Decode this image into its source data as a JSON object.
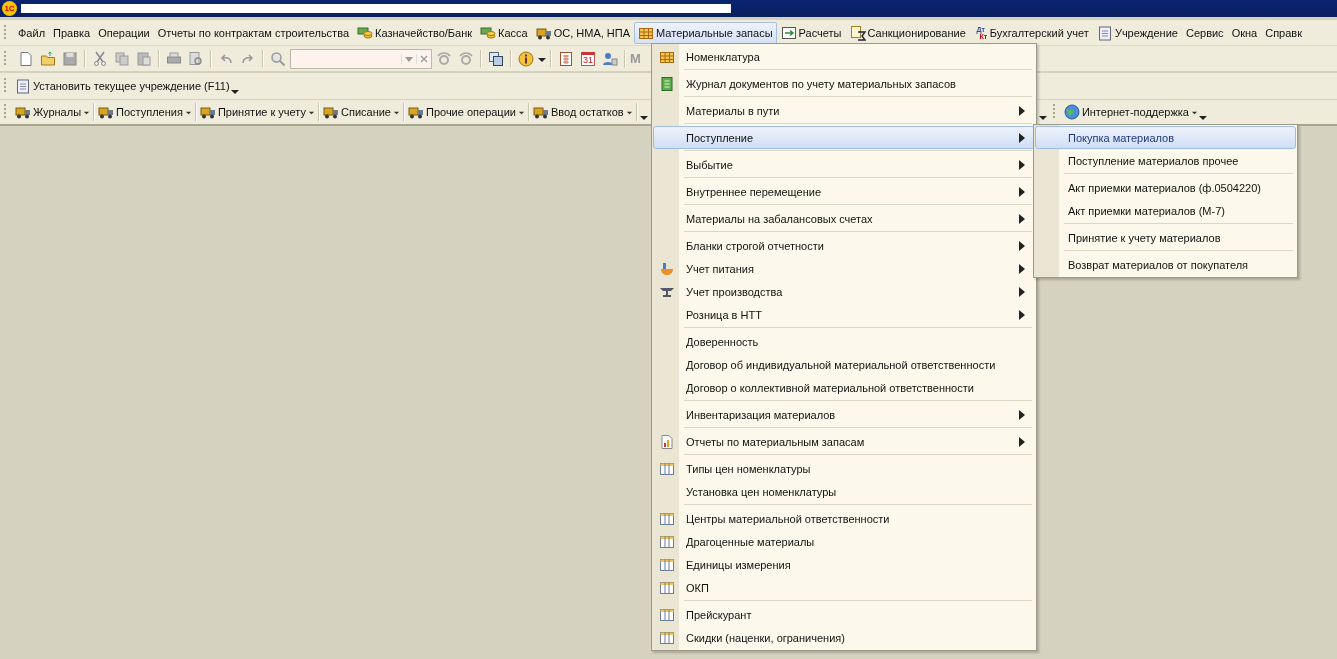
{
  "window": {
    "logo": "1С"
  },
  "menu_bar": [
    {
      "label": "Файл",
      "selected": false
    },
    {
      "label": "Правка",
      "selected": false
    },
    {
      "label": "Операции",
      "selected": false
    },
    {
      "label": "Отчеты по контрактам строительства",
      "selected": false
    },
    {
      "label": "Казначейство/Банк",
      "selected": false
    },
    {
      "label": "Касса",
      "selected": false
    },
    {
      "label": "ОС, НМА, НПА",
      "selected": false
    },
    {
      "label": "Материальные запасы",
      "selected": true
    },
    {
      "label": "Расчеты",
      "selected": false
    },
    {
      "label": "Санкционирование",
      "selected": false
    },
    {
      "label": "Бухгалтерский учет",
      "selected": false,
      "icon_top": "Дт",
      "icon_bottom": "Кт"
    },
    {
      "label": "Учреждение",
      "selected": false
    },
    {
      "label": "Сервис",
      "selected": false
    },
    {
      "label": "Окна",
      "selected": false
    },
    {
      "label": "Справк",
      "selected": false
    }
  ],
  "toolbar": {
    "calendar_day": "31",
    "cut_text": "M"
  },
  "institution_button": {
    "label": "Установить текущее учреждение (F11)"
  },
  "journal_toolbar": [
    {
      "label": "Журналы"
    },
    {
      "label": "Поступления"
    },
    {
      "label": "Принятие к учету"
    },
    {
      "label": "Списание"
    },
    {
      "label": "Прочие операции"
    },
    {
      "label": "Ввод остатков"
    }
  ],
  "support_button": {
    "label": "Интернет-поддержка"
  },
  "dropdown": [
    [
      {
        "label": "Номенклатура",
        "kind": "command",
        "selected": false
      }
    ],
    [
      {
        "label": "Журнал документов по учету материальных запасов",
        "kind": "command",
        "selected": false
      }
    ],
    [
      {
        "label": "Материалы в пути",
        "kind": "submenu",
        "selected": false
      }
    ],
    [
      {
        "label": "Поступление",
        "kind": "submenu",
        "selected": true
      }
    ],
    [
      {
        "label": "Выбытие",
        "kind": "submenu",
        "selected": false
      }
    ],
    [
      {
        "label": "Внутреннее перемещение",
        "kind": "submenu",
        "selected": false
      }
    ],
    [
      {
        "label": "Материалы на забалансовых счетах",
        "kind": "submenu",
        "selected": false
      }
    ],
    [
      {
        "label": "Бланки строгой отчетности",
        "kind": "submenu",
        "selected": false
      },
      {
        "label": "Учет питания",
        "kind": "submenu",
        "selected": false
      },
      {
        "label": "Учет производства",
        "kind": "submenu",
        "selected": false
      },
      {
        "label": "Розница в НТТ",
        "kind": "submenu",
        "selected": false
      }
    ],
    [
      {
        "label": "Доверенность",
        "kind": "command",
        "selected": false
      },
      {
        "label": "Договор об индивидуальной материальной ответственности",
        "kind": "command",
        "selected": false
      },
      {
        "label": "Договор о коллективной материальной ответственности",
        "kind": "command",
        "selected": false
      }
    ],
    [
      {
        "label": "Инвентаризация материалов",
        "kind": "submenu",
        "selected": false
      }
    ],
    [
      {
        "label": "Отчеты по материальным запасам",
        "kind": "submenu",
        "selected": false
      }
    ],
    [
      {
        "label": "Типы цен номенклатуры",
        "kind": "command",
        "selected": false
      },
      {
        "label": "Установка цен номенклатуры",
        "kind": "command",
        "selected": false
      }
    ],
    [
      {
        "label": "Центры материальной ответственности",
        "kind": "command",
        "selected": false
      },
      {
        "label": "Драгоценные материалы",
        "kind": "command",
        "selected": false
      },
      {
        "label": "Единицы измерения",
        "kind": "command",
        "selected": false
      },
      {
        "label": "ОКП",
        "kind": "command",
        "selected": false
      }
    ],
    [
      {
        "label": "Прейскурант",
        "kind": "command",
        "selected": false
      },
      {
        "label": "Скидки (наценки, ограничения)",
        "kind": "command",
        "selected": false
      }
    ]
  ],
  "submenu": [
    [
      {
        "label": "Покупка материалов",
        "selected": true
      },
      {
        "label": "Поступление материалов прочее",
        "selected": false
      }
    ],
    [
      {
        "label": "Акт приемки материалов (ф.0504220)",
        "selected": false
      },
      {
        "label": "Акт приемки материалов (М-7)",
        "selected": false
      }
    ],
    [
      {
        "label": "Принятие к учету материалов",
        "selected": false
      }
    ],
    [
      {
        "label": "Возврат материалов от покупателя",
        "selected": false
      }
    ]
  ]
}
